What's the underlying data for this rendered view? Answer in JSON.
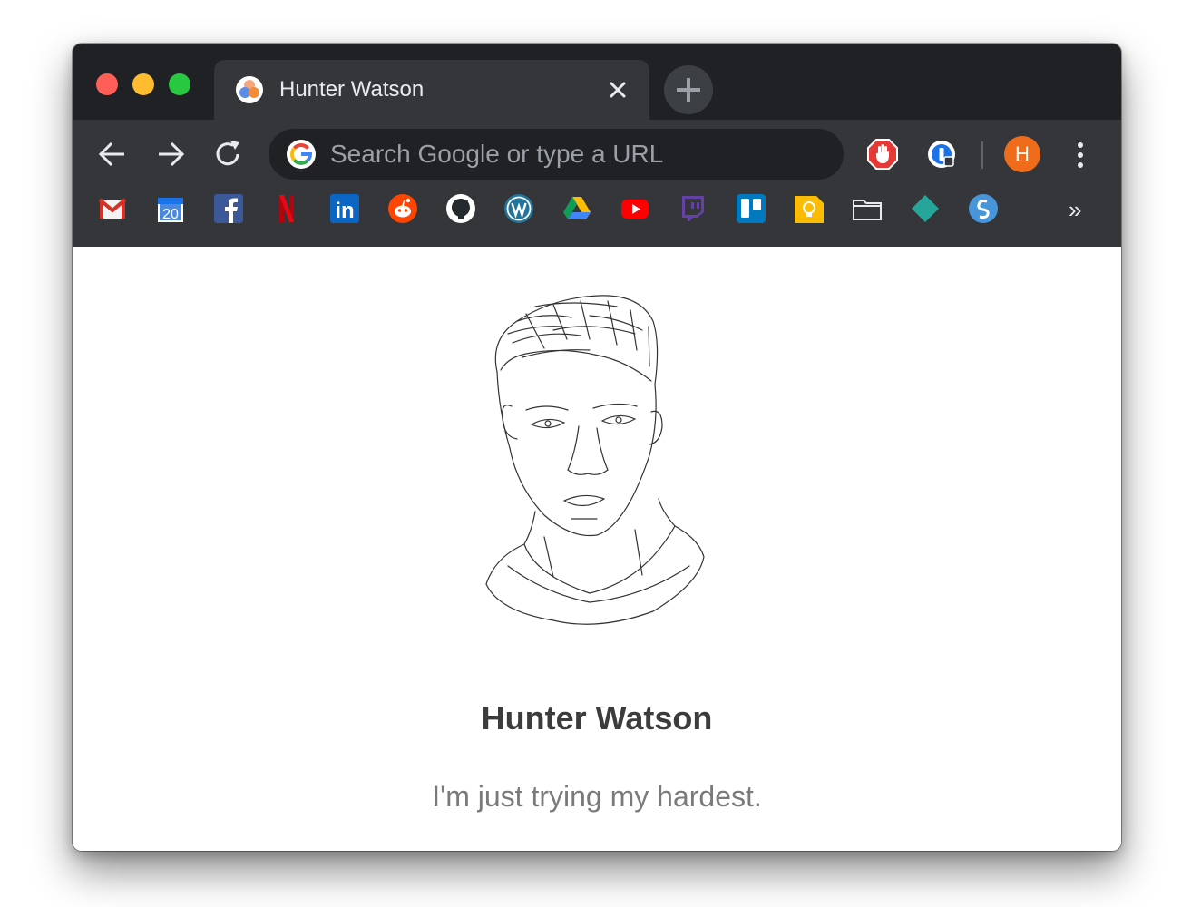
{
  "window": {
    "traffic_lights": [
      "close",
      "minimize",
      "zoom"
    ]
  },
  "tab": {
    "title": "Hunter Watson",
    "favicon": "tri-circle-favicon-icon"
  },
  "toolbar": {
    "back_icon": "back-arrow-icon",
    "forward_icon": "forward-arrow-icon",
    "reload_icon": "reload-icon",
    "omnibox_placeholder": "Search Google or type a URL",
    "extensions": [
      "adblock-hand-icon",
      "onepassword-icon"
    ],
    "profile_initial": "H",
    "menu_icon": "vertical-dots-menu-icon"
  },
  "bookmarks": {
    "items": [
      {
        "name": "Gmail",
        "icon": "gmail-icon"
      },
      {
        "name": "Calendar",
        "icon": "calendar-icon",
        "label": "20"
      },
      {
        "name": "Facebook",
        "icon": "facebook-icon"
      },
      {
        "name": "Netflix",
        "icon": "netflix-icon"
      },
      {
        "name": "LinkedIn",
        "icon": "linkedin-icon",
        "label": "in"
      },
      {
        "name": "Reddit",
        "icon": "reddit-icon"
      },
      {
        "name": "GitHub",
        "icon": "github-icon"
      },
      {
        "name": "WordPress",
        "icon": "wordpress-icon"
      },
      {
        "name": "Google Drive",
        "icon": "google-drive-icon"
      },
      {
        "name": "YouTube",
        "icon": "youtube-icon"
      },
      {
        "name": "Twitch",
        "icon": "twitch-icon"
      },
      {
        "name": "Trello",
        "icon": "trello-icon"
      },
      {
        "name": "Keep",
        "icon": "keep-lightbulb-icon"
      },
      {
        "name": "Folder",
        "icon": "folder-icon"
      },
      {
        "name": "Sketch",
        "icon": "diamond-icon"
      },
      {
        "name": "Simplenote",
        "icon": "simplenote-icon"
      }
    ],
    "overflow": "»"
  },
  "page": {
    "portrait": "line-drawing-portrait",
    "name": "Hunter Watson",
    "tagline": "I'm just trying my hardest."
  },
  "colors": {
    "tabstrip": "#202124",
    "toolbar": "#35363a",
    "avatar": "#ef6c1a",
    "name_text": "#3c3c3c",
    "tagline_text": "#7a7a7a"
  }
}
